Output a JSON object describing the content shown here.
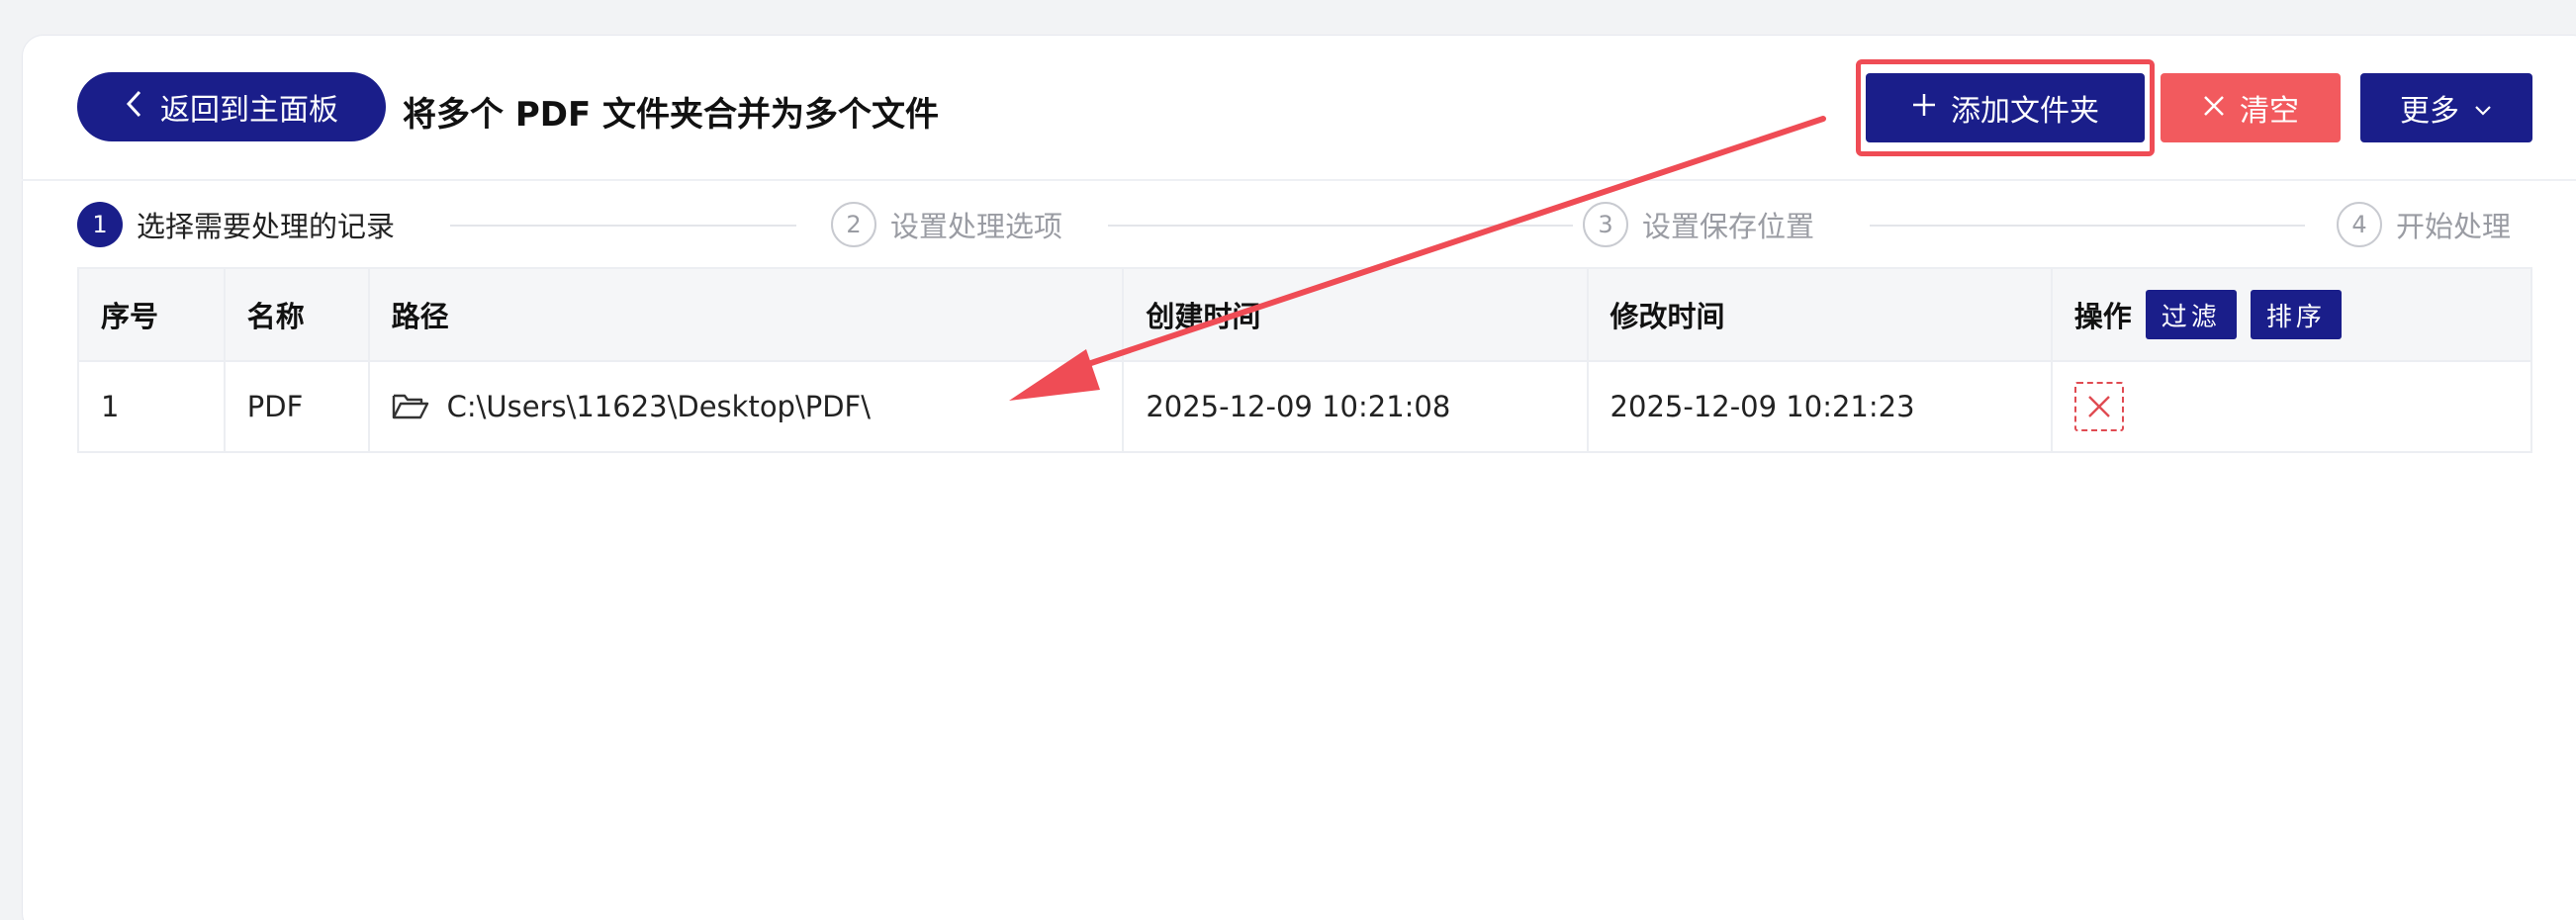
{
  "header": {
    "back_label": "返回到主面板",
    "title": "将多个 PDF 文件夹合并为多个文件",
    "add_folder_label": "添加文件夹",
    "clear_label": "清空",
    "more_label": "更多"
  },
  "steps": [
    {
      "num": "1",
      "label": "选择需要处理的记录",
      "state": "active"
    },
    {
      "num": "2",
      "label": "设置处理选项",
      "state": "inactive"
    },
    {
      "num": "3",
      "label": "设置保存位置",
      "state": "inactive"
    },
    {
      "num": "4",
      "label": "开始处理",
      "state": "inactive"
    }
  ],
  "table": {
    "columns": [
      "序号",
      "名称",
      "路径",
      "创建时间",
      "修改时间",
      "操作"
    ],
    "filter_label": "过滤",
    "sort_label": "排序",
    "rows": [
      {
        "index": "1",
        "name": "PDF",
        "path": "C:\\Users\\11623\\Desktop\\PDF\\",
        "created": "2025-12-09 10:21:08",
        "modified": "2025-12-09 10:21:23"
      }
    ]
  },
  "colors": {
    "primary": "#1a1e8a",
    "danger": "#f25a5e",
    "annotation": "#ef4c55"
  },
  "icons": {
    "back": "chevron-left-icon",
    "add": "plus-icon",
    "clear": "close-icon",
    "more": "chevron-down-icon",
    "folder": "folder-icon",
    "delete": "delete-icon"
  }
}
